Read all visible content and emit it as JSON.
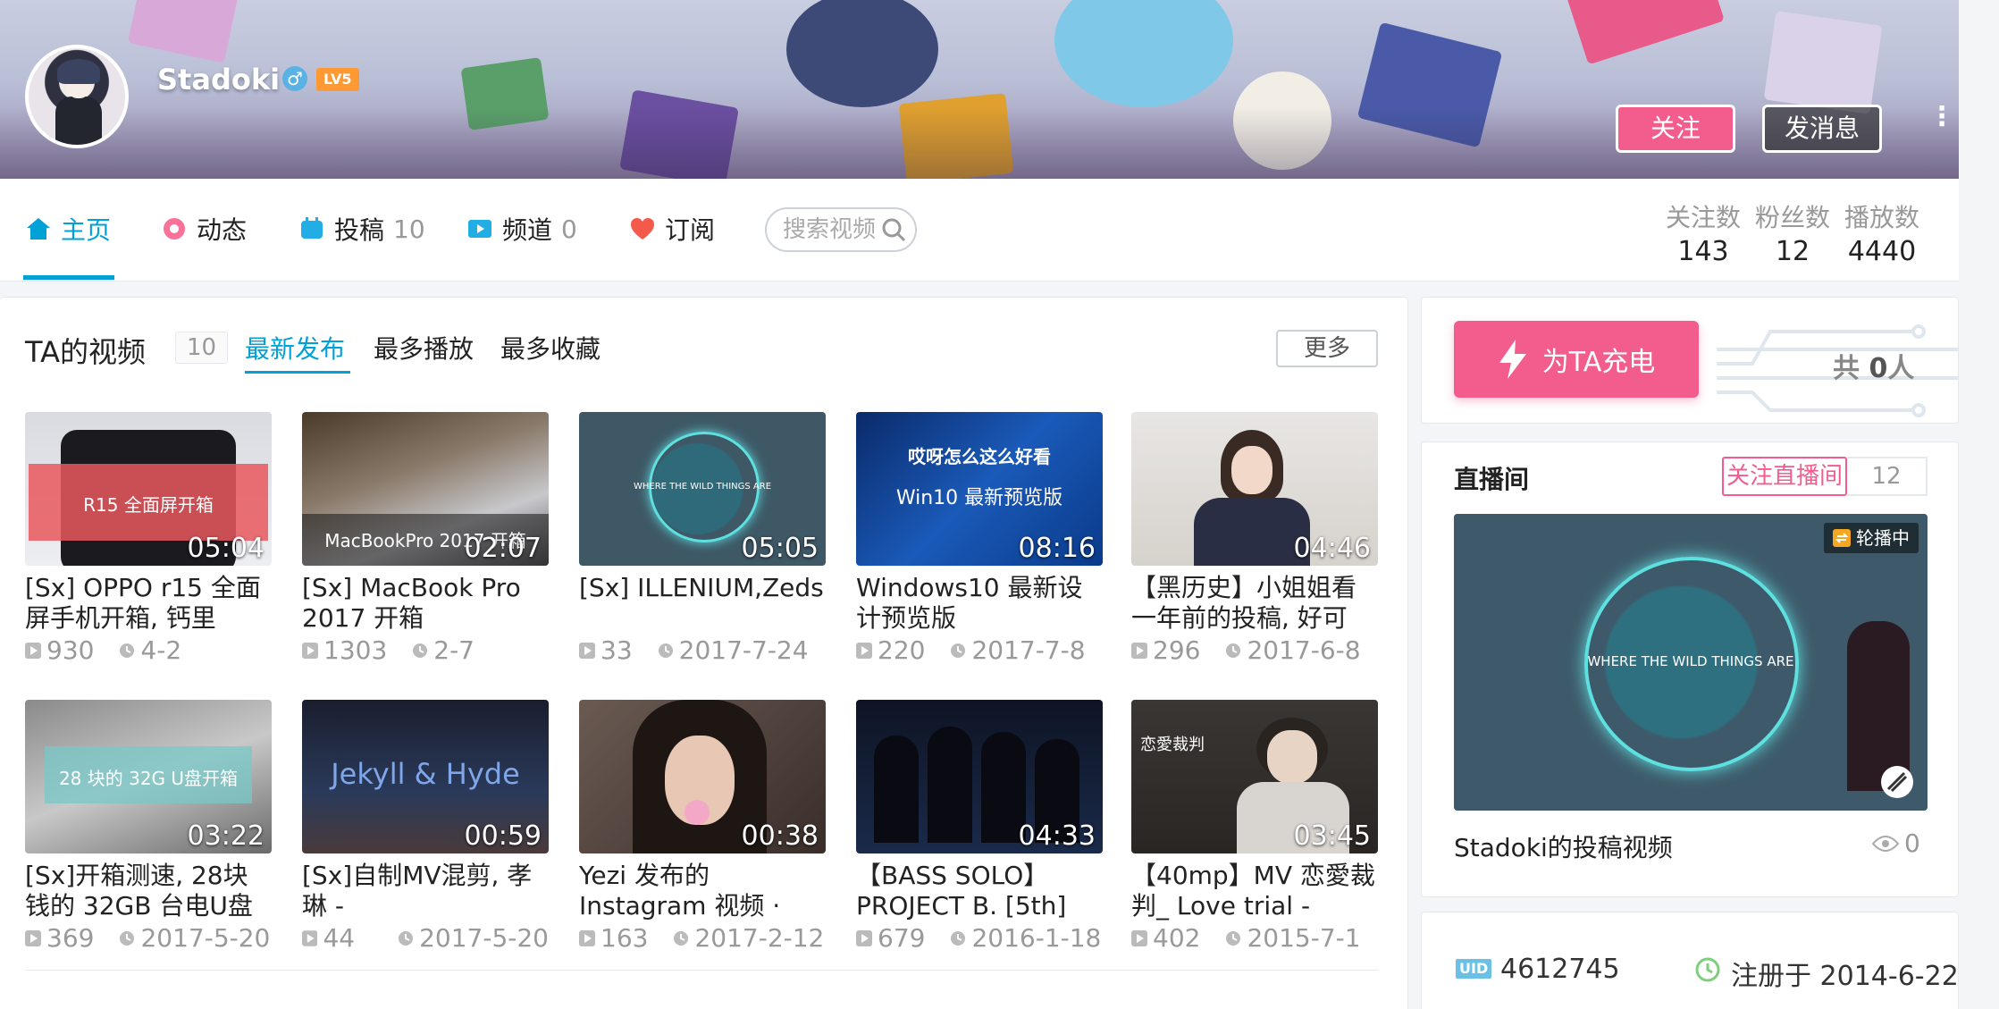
{
  "profile": {
    "username": "Stadoki",
    "gender_symbol": "♂",
    "level": "LV5",
    "follow_button": "关注",
    "message_button": "发消息",
    "more_icon": "⋮"
  },
  "nav": {
    "items": [
      {
        "label": "主页",
        "count": "",
        "icon": "home-icon"
      },
      {
        "label": "动态",
        "count": "",
        "icon": "feed-icon"
      },
      {
        "label": "投稿",
        "count": "10",
        "icon": "upload-icon"
      },
      {
        "label": "频道",
        "count": "0",
        "icon": "channel-icon"
      },
      {
        "label": "订阅",
        "count": "",
        "icon": "heart-icon"
      }
    ],
    "search_placeholder": "搜索视频",
    "stats": [
      {
        "label": "关注数",
        "value": "143"
      },
      {
        "label": "粉丝数",
        "value": "12"
      },
      {
        "label": "播放数",
        "value": "4440"
      }
    ]
  },
  "videos": {
    "title": "TA的视频",
    "count": "10",
    "tabs": [
      "最新发布",
      "最多播放",
      "最多收藏"
    ],
    "more_button": "更多",
    "items": [
      {
        "caption": "R15 全面屏开箱",
        "duration": "05:04",
        "title": "[Sx] OPPO r15 全面屏手机开箱, 钙里",
        "plays": "930",
        "date": "4-2"
      },
      {
        "caption": "MacBookPro 2017 开箱",
        "duration": "02:07",
        "title": "[Sx] MacBook Pro 2017 开箱",
        "plays": "1303",
        "date": "2-7"
      },
      {
        "caption": "WHERE THE WILD THINGS ARE",
        "duration": "05:05",
        "title": "[Sx] ILLENIUM,Zeds",
        "plays": "33",
        "date": "2017-7-24"
      },
      {
        "caption": "哎呀怎么这么好看",
        "caption2": "Win10 最新预览版",
        "duration": "08:16",
        "title": "Windows10 最新设计预览版",
        "plays": "220",
        "date": "2017-7-8"
      },
      {
        "caption": "",
        "duration": "04:46",
        "title": "【黑历史】小姐姐看一年前的投稿, 好可",
        "plays": "296",
        "date": "2017-6-8"
      },
      {
        "caption": "28 块的 32G U盘开箱",
        "duration": "03:22",
        "title": "[Sx]开箱测速, 28块钱的 32GB 台电U盘",
        "plays": "369",
        "date": "2017-5-20"
      },
      {
        "caption": "Jekyll & Hyde",
        "duration": "00:59",
        "title": "[Sx]自制MV混剪, 孝琳 -",
        "plays": "44",
        "date": "2017-5-20"
      },
      {
        "caption": "",
        "duration": "00:38",
        "title": "Yezi 发布的 Instagram 视频 ·",
        "plays": "163",
        "date": "2017-2-12"
      },
      {
        "caption": "",
        "duration": "04:33",
        "title": "【BASS SOLO】PROJECT B. [5th]",
        "plays": "679",
        "date": "2016-1-18"
      },
      {
        "caption": "恋愛裁判",
        "duration": "03:45",
        "title": "【40mp】MV 恋愛裁判_ Love trial -",
        "plays": "402",
        "date": "2015-7-1"
      }
    ]
  },
  "charge": {
    "button": "为TA充电",
    "total_prefix": "共",
    "total_count": "0",
    "total_suffix": "人"
  },
  "live": {
    "title": "直播间",
    "follow_button": "关注直播间",
    "count": "12",
    "badge": "轮播中",
    "overlay_text": "WHERE THE WILD THINGS ARE",
    "name": "Stadoki的投稿视频",
    "views": "0"
  },
  "info": {
    "uid_label": "UID",
    "uid": "4612745",
    "registered": "注册于 2014-6-22"
  },
  "colors": {
    "accent_blue": "#00a1d6",
    "accent_pink": "#f25d8e",
    "level_orange": "#ff9933"
  }
}
